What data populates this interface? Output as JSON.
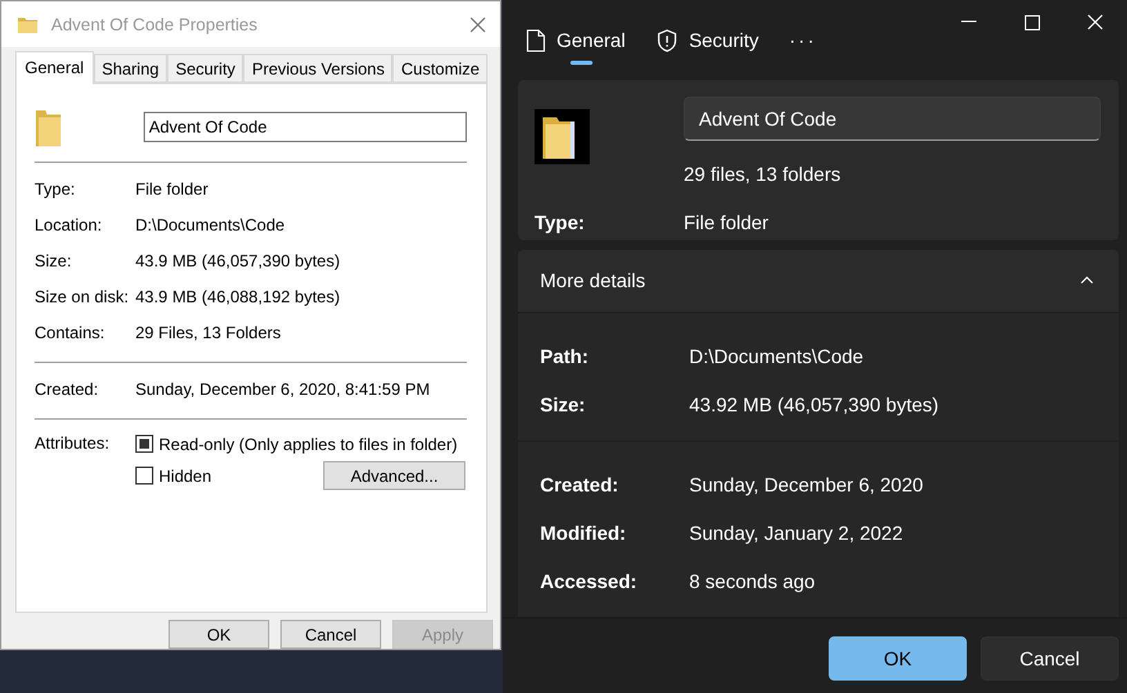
{
  "classic": {
    "title": "Advent Of Code Properties",
    "tabs": [
      {
        "label": "General",
        "selected": true
      },
      {
        "label": "Sharing",
        "selected": false
      },
      {
        "label": "Security",
        "selected": false
      },
      {
        "label": "Previous Versions",
        "selected": false
      },
      {
        "label": "Customize",
        "selected": false
      }
    ],
    "name": "Advent Of Code",
    "groups": [
      [
        {
          "label": "Type:",
          "value": "File folder"
        },
        {
          "label": "Location:",
          "value": "D:\\Documents\\Code"
        },
        {
          "label": "Size:",
          "value": "43.9 MB (46,057,390 bytes)"
        },
        {
          "label": "Size on disk:",
          "value": "43.9 MB (46,088,192 bytes)"
        },
        {
          "label": "Contains:",
          "value": "29 Files, 13 Folders"
        }
      ],
      [
        {
          "label": "Created:",
          "value": "Sunday, December 6, 2020, 8:41:59 PM"
        }
      ]
    ],
    "attributes_label": "Attributes:",
    "attributes": [
      {
        "label": "Read-only (Only applies to files in folder)",
        "checked": true
      },
      {
        "label": "Hidden",
        "checked": false
      }
    ],
    "advanced_button": "Advanced...",
    "buttons": [
      {
        "label": "OK",
        "disabled": false
      },
      {
        "label": "Cancel",
        "disabled": false
      },
      {
        "label": "Apply",
        "disabled": true
      }
    ]
  },
  "modern": {
    "tabs": [
      {
        "label": "General",
        "kind": "file",
        "selected": true
      },
      {
        "label": "Security",
        "kind": "shield",
        "selected": false
      }
    ],
    "more_tabs": "···",
    "name": "Advent Of Code",
    "contents": "29 files, 13 folders",
    "type_label": "Type:",
    "type_value": "File folder",
    "details": {
      "title": "More details",
      "expanded": true,
      "groups": [
        [
          {
            "label": "Path:",
            "value": "D:\\Documents\\Code"
          },
          {
            "label": "Size:",
            "value": "43.92 MB (46,057,390 bytes)"
          }
        ],
        [
          {
            "label": "Created:",
            "value": "Sunday, December 6, 2020"
          },
          {
            "label": "Modified:",
            "value": "Sunday, January 2, 2022"
          },
          {
            "label": "Accessed:",
            "value": "8 seconds ago"
          }
        ]
      ]
    },
    "buttons": [
      {
        "label": "OK",
        "primary": true
      },
      {
        "label": "Cancel",
        "primary": false
      }
    ]
  }
}
